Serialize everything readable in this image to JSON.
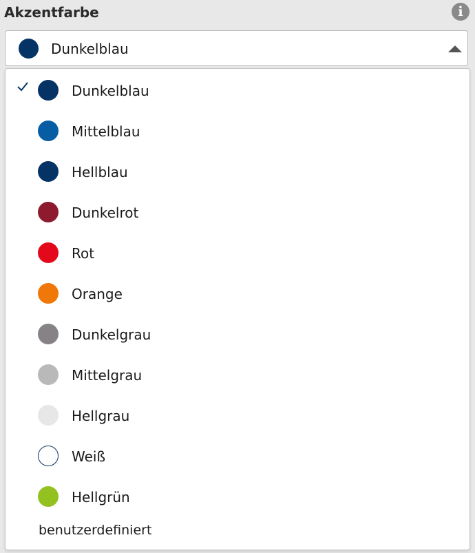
{
  "field": {
    "label": "Akzentfarbe",
    "info_glyph": "i"
  },
  "select": {
    "value": "Dunkelblau",
    "swatch_color": "#063366",
    "caret_icon": "caret-up-icon"
  },
  "options": [
    {
      "label": "Dunkelblau",
      "color": "#063366",
      "selected": true
    },
    {
      "label": "Mittelblau",
      "color": "#065da3",
      "selected": false
    },
    {
      "label": "Hellblau",
      "color": "#063366",
      "selected": false
    },
    {
      "label": "Dunkelrot",
      "color": "#8e1a2e",
      "selected": false
    },
    {
      "label": "Rot",
      "color": "#e3081a",
      "selected": false
    },
    {
      "label": "Orange",
      "color": "#f07808",
      "selected": false
    },
    {
      "label": "Dunkelgrau",
      "color": "#878285",
      "selected": false
    },
    {
      "label": "Mittelgrau",
      "color": "#b9b9b9",
      "selected": false
    },
    {
      "label": "Hellgrau",
      "color": "#e7e7e7",
      "selected": false
    },
    {
      "label": "Weiß",
      "color": "#ffffff",
      "border": "#063366",
      "selected": false
    },
    {
      "label": "Hellgrün",
      "color": "#93c11f",
      "selected": false
    }
  ],
  "custom_option": {
    "label": "benutzerdefiniert"
  },
  "colors": {
    "check": "#063366",
    "background": "#e8e8e8"
  }
}
